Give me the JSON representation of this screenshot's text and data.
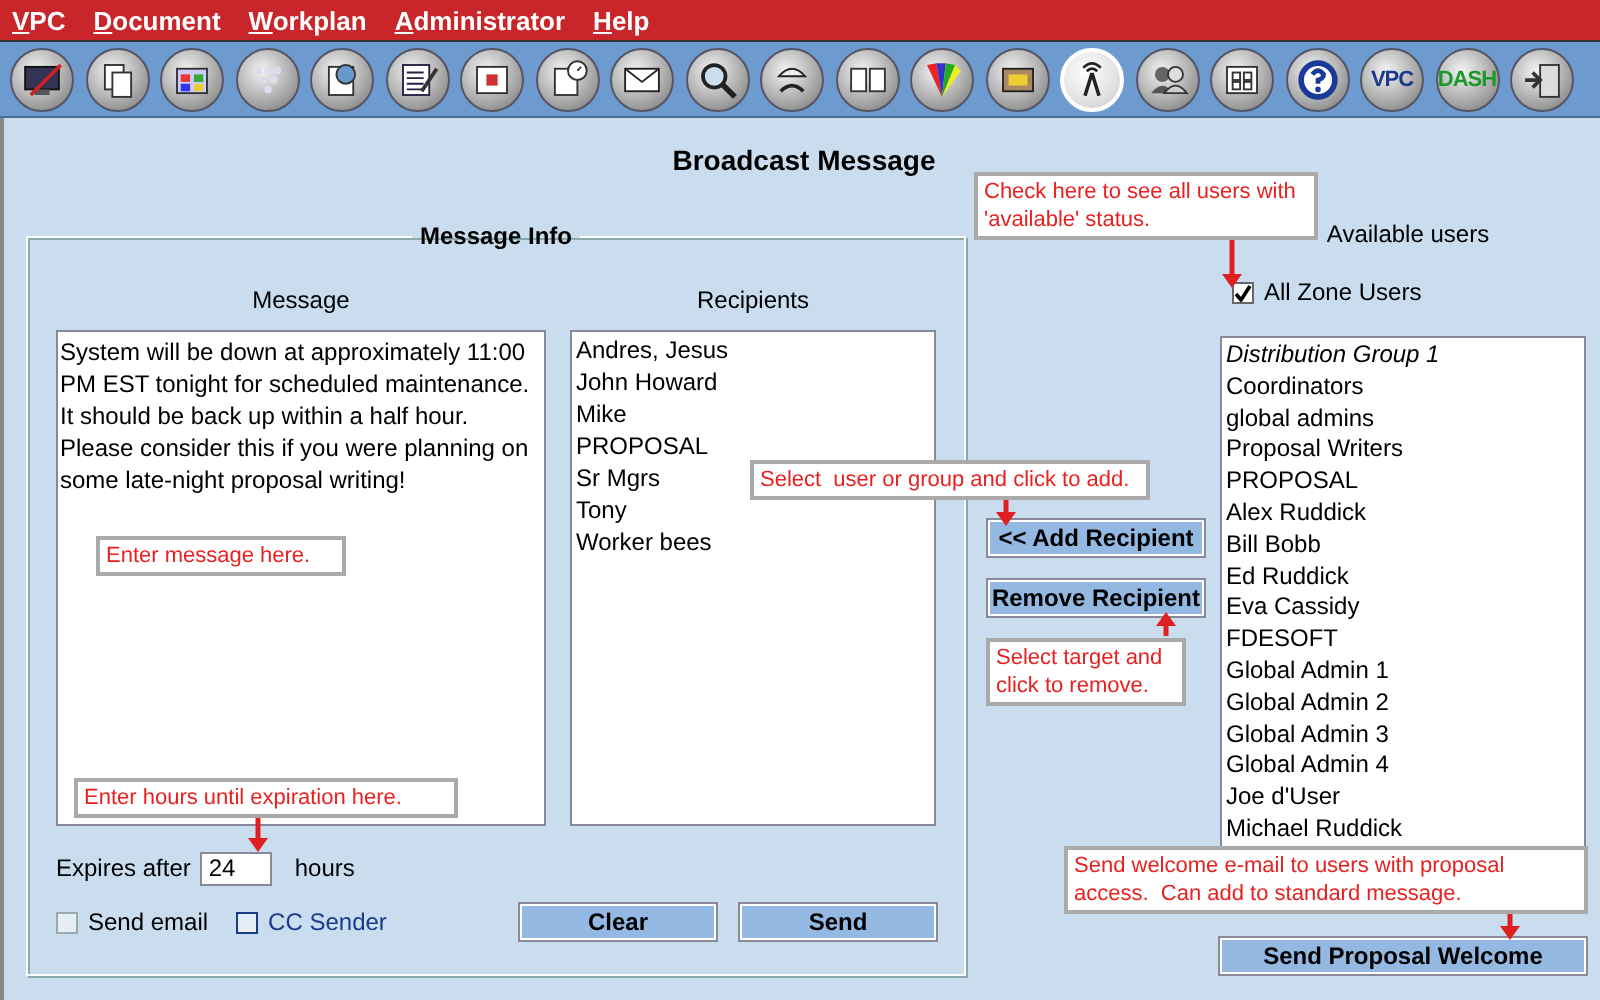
{
  "menu": [
    {
      "label": "VPC"
    },
    {
      "label": "Document"
    },
    {
      "label": "Workplan"
    },
    {
      "label": "Administrator"
    },
    {
      "label": "Help"
    }
  ],
  "toolbar": [
    {
      "kind": "icon",
      "selected": false
    },
    {
      "kind": "icon",
      "selected": false
    },
    {
      "kind": "icon",
      "selected": false
    },
    {
      "kind": "icon",
      "selected": false
    },
    {
      "kind": "icon",
      "selected": false
    },
    {
      "kind": "icon",
      "selected": false
    },
    {
      "kind": "icon",
      "selected": false
    },
    {
      "kind": "icon",
      "selected": false
    },
    {
      "kind": "icon",
      "selected": false
    },
    {
      "kind": "icon",
      "selected": false
    },
    {
      "kind": "icon",
      "selected": false
    },
    {
      "kind": "icon",
      "selected": false
    },
    {
      "kind": "icon",
      "selected": false
    },
    {
      "kind": "icon",
      "selected": false
    },
    {
      "kind": "icon",
      "selected": true
    },
    {
      "kind": "icon",
      "selected": false
    },
    {
      "kind": "icon",
      "selected": false
    },
    {
      "kind": "icon",
      "selected": false
    },
    {
      "kind": "text",
      "label": "VPC",
      "color": "#1a3a8a",
      "selected": false
    },
    {
      "kind": "text",
      "label": "DASH",
      "color": "#1a9a2a",
      "selected": false
    },
    {
      "kind": "icon",
      "selected": false
    }
  ],
  "title": "Broadcast Message",
  "message_info": {
    "legend": "Message Info",
    "message_label": "Message",
    "message": "System will be down at approximately 11:00 PM EST tonight for scheduled maintenance. It should be back up within a half hour. Please consider this if you were planning on some late-night proposal writing!",
    "recipients_label": "Recipients",
    "recipients": [
      "Andres, Jesus",
      "John Howard",
      "Mike",
      "PROPOSAL",
      "Sr Mgrs",
      "Tony",
      "Worker bees"
    ],
    "expires_label": "Expires after",
    "expires_value": "24",
    "expires_unit": "hours",
    "checkboxes": [
      {
        "label": "Send email",
        "checked": false,
        "disabled": true
      },
      {
        "label": "CC Sender",
        "checked": false,
        "disabled": false
      }
    ],
    "buttons": [
      "Clear",
      "Send"
    ]
  },
  "middle_buttons": [
    "<< Add Recipient",
    "Remove Recipient"
  ],
  "available": {
    "label": "Available users",
    "all_zone": {
      "label": "All Zone Users",
      "checked": true
    },
    "users": [
      {
        "name": "Distribution Group 1",
        "kind": "group"
      },
      {
        "name": "Coordinators",
        "kind": "user"
      },
      {
        "name": "global admins",
        "kind": "user"
      },
      {
        "name": "Proposal Writers",
        "kind": "user"
      },
      {
        "name": "PROPOSAL",
        "kind": "user"
      },
      {
        "name": "Alex Ruddick",
        "kind": "user"
      },
      {
        "name": "Bill Bobb",
        "kind": "user"
      },
      {
        "name": "Ed Ruddick",
        "kind": "user"
      },
      {
        "name": "Eva Cassidy",
        "kind": "user"
      },
      {
        "name": "FDESOFT",
        "kind": "user"
      },
      {
        "name": "Global Admin 1",
        "kind": "user"
      },
      {
        "name": "Global Admin 2",
        "kind": "user"
      },
      {
        "name": "Global Admin 3",
        "kind": "user"
      },
      {
        "name": "Global Admin 4",
        "kind": "user"
      },
      {
        "name": "Joe d'User",
        "kind": "user"
      },
      {
        "name": "Michael Ruddick",
        "kind": "user"
      }
    ],
    "button": "Send Proposal Welcome"
  },
  "callouts": [
    "Check here to see all users with 'available' status.",
    "Select  user or group and click to add.",
    "Enter message here.",
    "Select target and click to remove.",
    "Enter hours until expiration here.",
    "Send welcome e-mail to users with proposal access.  Can add to standard message."
  ]
}
